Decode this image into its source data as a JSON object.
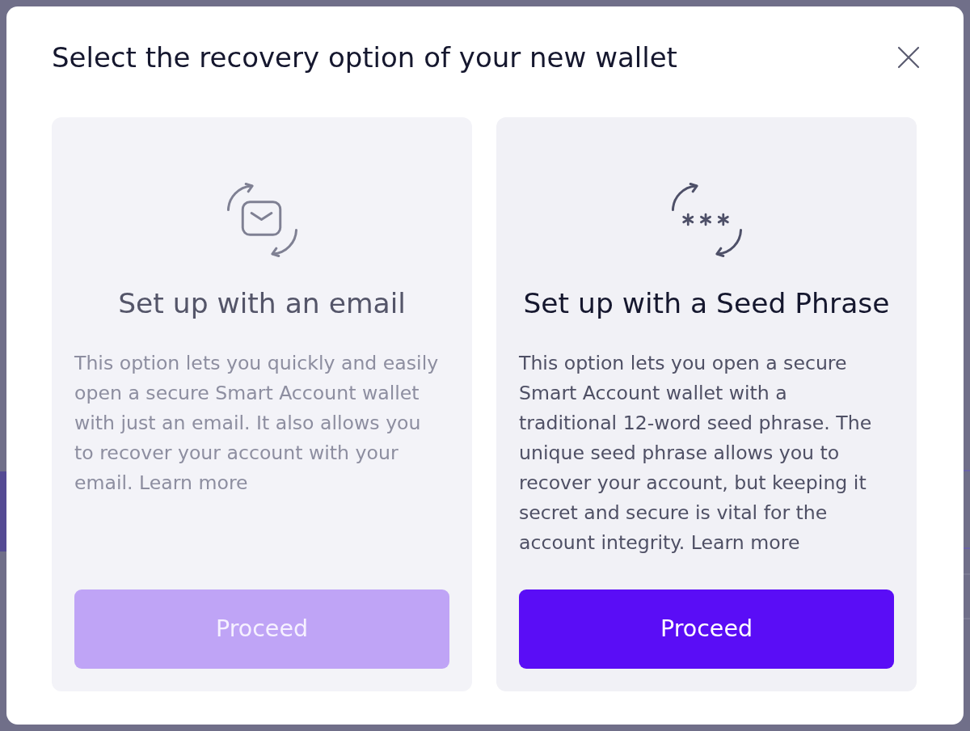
{
  "dialog": {
    "title": "Select the recovery option of your new wallet"
  },
  "options": [
    {
      "kind": "email",
      "title": "Set up with an email",
      "description": "This option lets you quickly and easily open a secure Smart Account wallet with just an email. It also allows you to recover your account with your email.",
      "link": "Learn more",
      "button": "Proceed",
      "selected": false
    },
    {
      "kind": "seed",
      "title": "Set up with a Seed Phrase",
      "description": "This option lets you open a secure Smart Account wallet with a traditional 12-word seed phrase. The unique seed phrase allows you to recover your account, but keeping it secret and secure is vital for the account integrity.",
      "link": "Learn more",
      "button": "Proceed",
      "selected": true
    }
  ]
}
